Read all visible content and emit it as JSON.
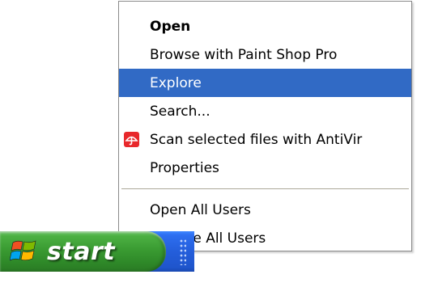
{
  "taskbar": {
    "start_label": "start",
    "start_logo_icon": "windows-flag-icon"
  },
  "context_menu": {
    "highlight_color": "#316ac5",
    "items": [
      {
        "label": "Open",
        "default": true
      },
      {
        "label": "Browse with Paint Shop Pro"
      },
      {
        "label": "Explore",
        "highlighted": true
      },
      {
        "label": "Search..."
      },
      {
        "label": "Scan selected files with AntiVir",
        "icon": "antivir-umbrella-icon",
        "icon_color": "#e8282b"
      },
      {
        "label": "Properties"
      },
      {
        "label": "Open All Users"
      },
      {
        "label": "Explore All Users"
      }
    ]
  }
}
